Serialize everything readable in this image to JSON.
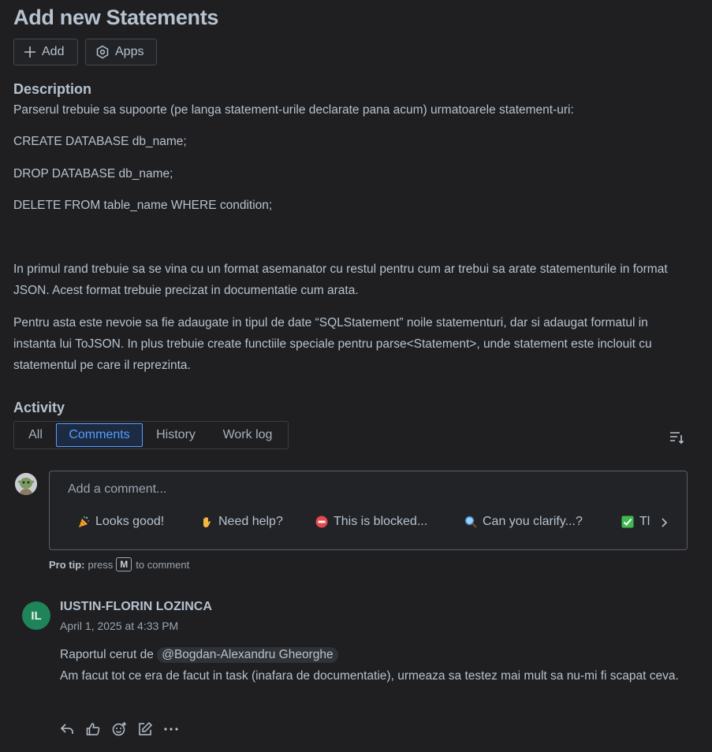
{
  "issue": {
    "title": "Add new Statements",
    "buttons": {
      "add": "Add",
      "apps": "Apps"
    }
  },
  "description": {
    "heading": "Description",
    "paragraphs": [
      "Parserul trebuie sa supoorte (pe langa statement-urile declarate pana acum) urmatoarele statement-uri:",
      "CREATE DATABASE db_name;",
      "DROP DATABASE db_name;",
      "DELETE FROM table_name WHERE condition;",
      "In primul rand trebuie sa se vina cu un format asemanator cu restul pentru cum ar trebui sa arate statementurile in format JSON. Acest format trebuie precizat in documentatie cum arata.",
      "Pentru asta este nevoie sa fie adaugate in tipul de date “SQLStatement” noile statementuri, dar si adaugat formatul in instanta lui ToJSON. In plus trebuie create functiile speciale pentru parse<Statement>, unde statement este inclouit cu statementul pe care il reprezinta."
    ]
  },
  "activity": {
    "heading": "Activity",
    "tabs": [
      "All",
      "Comments",
      "History",
      "Work log"
    ],
    "active_tab": "Comments",
    "sort_icon": "sort-icon"
  },
  "composer": {
    "placeholder": "Add a comment...",
    "quick_replies": [
      {
        "emoji": "party-popper",
        "label": "Looks good!"
      },
      {
        "emoji": "waving-hand",
        "label": "Need help?"
      },
      {
        "emoji": "no-entry",
        "label": "This is blocked..."
      },
      {
        "emoji": "magnifying-glass",
        "label": "Can you clarify...?"
      },
      {
        "emoji": "check-mark",
        "label": "Tl"
      }
    ],
    "protip": {
      "label": "Pro tip:",
      "before": "press",
      "key": "M",
      "after": "to comment"
    }
  },
  "comment": {
    "initials": "IL",
    "author": "IUSTIN-FLORIN LOZINCA",
    "timestamp": "April 1, 2025 at 4:33 PM",
    "line1_prefix": "Raportul cerut de",
    "mention": "@Bogdan-Alexandru Gheorghe",
    "line2": "Am facut tot ce era de facut in task (inafara de documentatie), urmeaza sa testez mai mult sa nu-mi fi scapat ceva.",
    "actions": [
      "reply-icon",
      "like-icon",
      "add-reaction-icon",
      "edit-icon",
      "more-icon"
    ]
  },
  "colors": {
    "background": "#1f1f21",
    "text": "#b6c2cf",
    "accent": "#579dff",
    "avatar_green": "#1f845a"
  }
}
